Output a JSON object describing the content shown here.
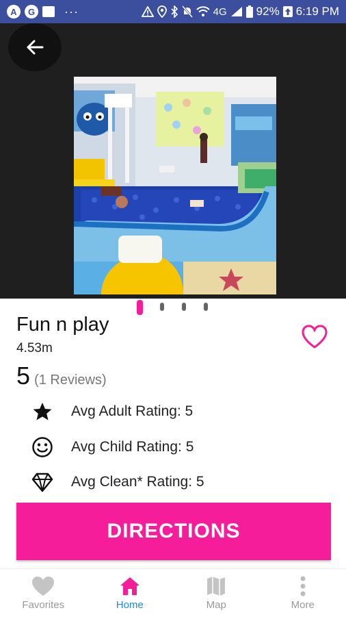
{
  "status_bar": {
    "app_icons": [
      "A",
      "G"
    ],
    "overflow": "···",
    "signal_label": "4G",
    "battery": "92%",
    "time": "6:19 PM"
  },
  "header": {
    "back_icon": "arrow-left-icon",
    "image_count": 4,
    "active_image": 1
  },
  "place": {
    "name": "Fun n play",
    "distance": "4.53m",
    "rating": "5",
    "reviews": "(1 Reviews)",
    "favorite_color": "#f51d9a"
  },
  "ratings": [
    {
      "icon": "star-icon",
      "label": "Avg Adult Rating: 5"
    },
    {
      "icon": "smiley-icon",
      "label": "Avg Child Rating: 5"
    },
    {
      "icon": "diamond-icon",
      "label": "Avg Clean* Rating: 5"
    }
  ],
  "actions": {
    "directions": "DIRECTIONS"
  },
  "nav": {
    "items": [
      {
        "label": "Favorites",
        "icon": "heart-icon"
      },
      {
        "label": "Home",
        "icon": "home-icon"
      },
      {
        "label": "Map",
        "icon": "map-icon"
      },
      {
        "label": "More",
        "icon": "more-vertical-icon"
      }
    ],
    "active_color": "#1e88e5",
    "inactive_color": "#9e9e9e"
  },
  "colors": {
    "accent": "#f51d9a",
    "status_bar": "#3c4f9f"
  }
}
